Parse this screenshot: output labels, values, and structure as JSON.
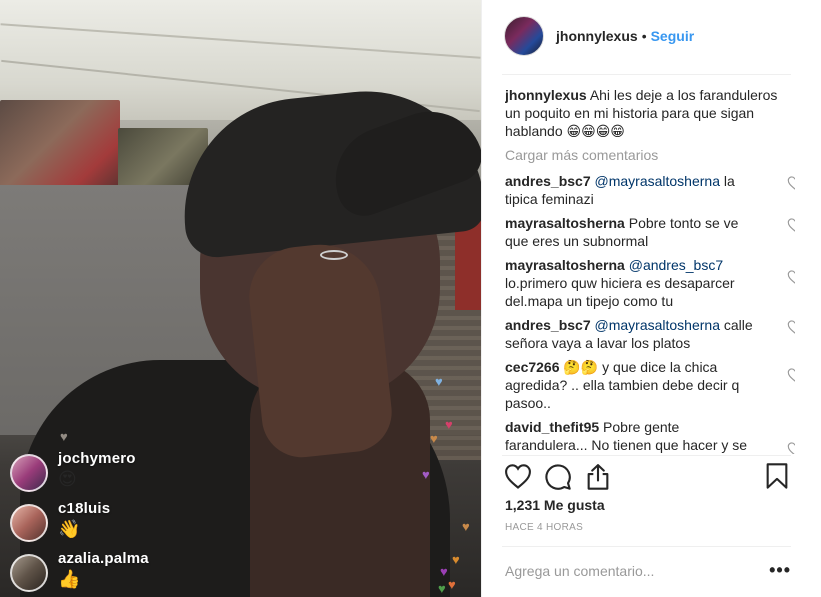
{
  "live": {
    "comments": [
      {
        "user": "jochymero",
        "text": "😍"
      },
      {
        "user": "c18luis",
        "text": "👋"
      },
      {
        "user": "azalia.palma",
        "text": "👍"
      }
    ]
  },
  "post": {
    "author": "jhonnylexus",
    "separator": "•",
    "follow_label": "Seguir",
    "caption": {
      "user": "jhonnylexus",
      "text": "Ahi les deje a los faranduleros un poquito en mi historia para que sigan hablando 😁😁😁😁"
    },
    "load_more_label": "Cargar más comentarios",
    "comments": [
      {
        "user": "andres_bsc7",
        "mention": "@mayrasaltosherna",
        "text": "la tipica feminazi"
      },
      {
        "user": "mayrasaltosherna",
        "mention": "",
        "text": "Pobre tonto se ve que eres un subnormal"
      },
      {
        "user": "mayrasaltosherna",
        "mention": "@andres_bsc7",
        "text": "lo.primero quw hiciera es desaparcer del.mapa un tipejo como tu"
      },
      {
        "user": "andres_bsc7",
        "mention": "@mayrasaltosherna",
        "text": "calle señora vaya a lavar los platos"
      },
      {
        "user": "cec7266",
        "mention": "",
        "text": "🤔🤔 y que dice la chica agredida? .. ella tambien debe decir q pasoo.."
      },
      {
        "user": "david_thefit95",
        "mention": "",
        "text": "Pobre gente farandulera... No tienen que hacer y se"
      }
    ],
    "likes": "1,231 Me gusta",
    "time_ago": "HACE 4 HORAS",
    "add_comment_placeholder": "Agrega un comentario...",
    "more_label": "•••"
  },
  "colors": {
    "link_blue": "#3897f0",
    "mention_blue": "#003569",
    "muted": "#999999",
    "text": "#262626"
  },
  "icons": [
    "heart-icon",
    "comment-icon",
    "share-icon",
    "bookmark-icon",
    "small-heart-icon"
  ]
}
